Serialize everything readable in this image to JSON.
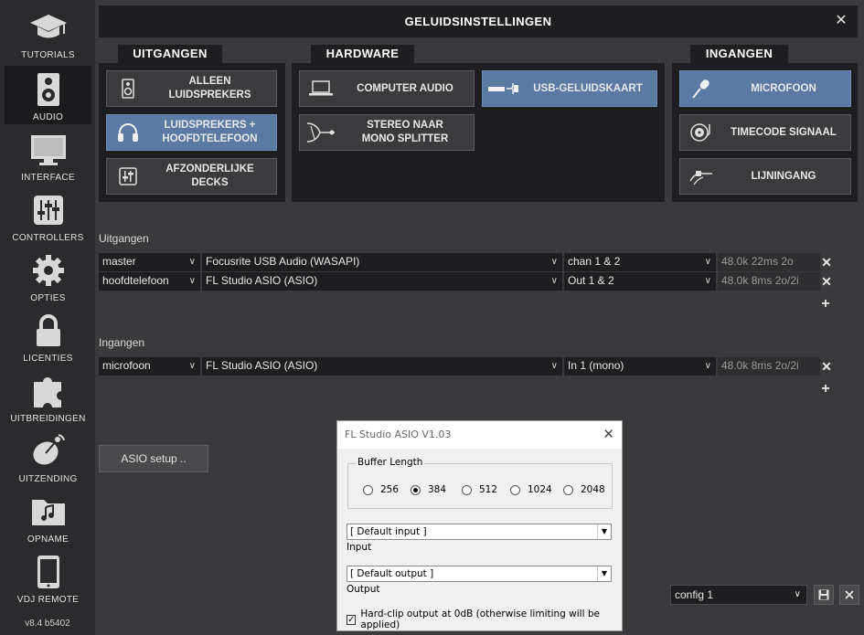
{
  "sidebar": {
    "items": [
      {
        "label": "TUTORIALS",
        "icon": "graduation-cap-icon"
      },
      {
        "label": "AUDIO",
        "icon": "speaker-icon",
        "active": true
      },
      {
        "label": "INTERFACE",
        "icon": "monitor-icon"
      },
      {
        "label": "CONTROLLERS",
        "icon": "sliders-icon"
      },
      {
        "label": "OPTIES",
        "icon": "gear-icon"
      },
      {
        "label": "LICENTIES",
        "icon": "lock-icon"
      },
      {
        "label": "UITBREIDINGEN",
        "icon": "puzzle-icon"
      },
      {
        "label": "UITZENDING",
        "icon": "satellite-dish-icon"
      },
      {
        "label": "OPNAME",
        "icon": "music-folder-icon"
      },
      {
        "label": "VDJ REMOTE",
        "icon": "tablet-icon"
      }
    ],
    "version": "v8.4 b5402"
  },
  "header": {
    "title": "GELUIDSINSTELLINGEN",
    "close": "✕"
  },
  "sections": {
    "outputs": {
      "title": "UITGANGEN",
      "buttons": [
        {
          "label": "ALLEEN\nLUIDSPREKERS",
          "icon": "speaker-icon",
          "selected": false
        },
        {
          "label": "LUIDSPREKERS +\nHOOFDTELEFOON",
          "icon": "headphones-icon",
          "selected": true
        },
        {
          "label": "AFZONDERLIJKE\nDECKS",
          "icon": "mixer-icon",
          "selected": false
        }
      ]
    },
    "hardware": {
      "title": "HARDWARE",
      "buttons": [
        {
          "label": "COMPUTER AUDIO",
          "icon": "laptop-icon",
          "selected": false
        },
        {
          "label": "USB-GELUIDSKAART",
          "icon": "usb-soundcard-icon",
          "selected": true
        },
        {
          "label": "STEREO NAAR\nMONO SPLITTER",
          "icon": "splitter-cable-icon",
          "selected": false
        }
      ]
    },
    "inputs": {
      "title": "INGANGEN",
      "buttons": [
        {
          "label": "MICROFOON",
          "icon": "microphone-icon",
          "selected": true
        },
        {
          "label": "TIMECODE SIGNAAL",
          "icon": "timecode-vinyl-icon",
          "selected": false
        },
        {
          "label": "LIJNINGANG",
          "icon": "line-cable-icon",
          "selected": false
        }
      ]
    }
  },
  "routing": {
    "outputs_label": "Uitgangen",
    "outputs": [
      {
        "channel": "master",
        "device": "Focusrite USB Audio (WASAPI)",
        "ports": "chan 1 & 2",
        "info": "48.0k 22ms 2o"
      },
      {
        "channel": "hoofdtelefoon",
        "device": "FL Studio ASIO (ASIO)",
        "ports": "Out 1 & 2",
        "info": "48.0k 8ms 2o/2i"
      }
    ],
    "inputs_label": "Ingangen",
    "inputs": [
      {
        "channel": "microfoon",
        "device": "FL Studio ASIO (ASIO)",
        "ports": "In 1 (mono)",
        "info": "48.0k 8ms 2o/2i"
      }
    ],
    "remove": "✕",
    "add": "+"
  },
  "asio_setup": "ASIO setup ..",
  "config": {
    "selected": "config 1"
  },
  "dialog": {
    "title": "FL Studio ASIO V1.03",
    "close": "✕",
    "buffer_legend": "Buffer Length",
    "buffer_options": [
      "256",
      "384",
      "512",
      "1024",
      "2048"
    ],
    "buffer_selected": "384",
    "input_value": "[ Default input ]",
    "input_label": "Input",
    "output_value": "[ Default output ]",
    "output_label": "Output",
    "hardclip_label": "Hard-clip output at 0dB (otherwise limiting will be applied)",
    "hardclip_checked": true
  }
}
